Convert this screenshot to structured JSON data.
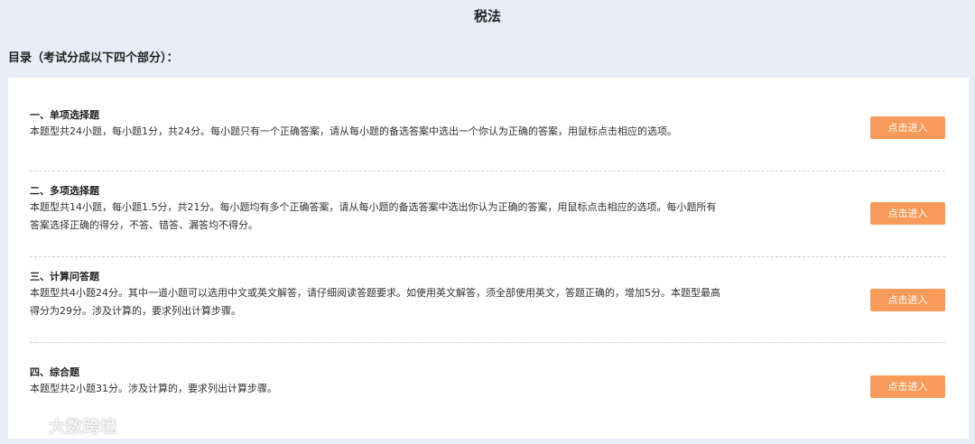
{
  "page": {
    "title": "税法",
    "toc_heading": "目录（考试分成以下四个部分）："
  },
  "sections": [
    {
      "title": "一、单项选择题",
      "desc_lines": [
        "本题型共24小题，每小题1分，共24分。每小题只有一个正确答案，请从每小题的备选答案中选出一个你认为正确的答案，用鼠标点击相应的选项。"
      ],
      "button_label": "点击进入"
    },
    {
      "title": "二、多项选择题",
      "desc_lines": [
        "本题型共14小题，每小题1.5分，共21分。每小题均有多个正确答案，请从每小题的备选答案中选出你认为正确的答案，用鼠标点击相应的选项。每小题所有",
        "答案选择正确的得分，不答、错答、漏答均不得分。"
      ],
      "button_label": "点击进入"
    },
    {
      "title": "三、计算问答题",
      "desc_lines": [
        "本题型共4小题24分。其中一道小题可以选用中文或英文解答，请仔细阅读答题要求。如使用英文解答，须全部使用英文，答题正确的，增加5分。本题型最高",
        "得分为29分。涉及计算的，要求列出计算步骤。"
      ],
      "button_label": "点击进入"
    },
    {
      "title": "四、综合题",
      "desc_lines": [
        "本题型共2小题31分。涉及计算的，要求列出计算步骤。"
      ],
      "button_label": "点击进入"
    }
  ],
  "watermark": {
    "text": "大数跨境",
    "icon": "wechat-logo-icon"
  },
  "colors": {
    "background": "#e9edf7",
    "panel": "#ffffff",
    "button": "#f79a5a"
  }
}
